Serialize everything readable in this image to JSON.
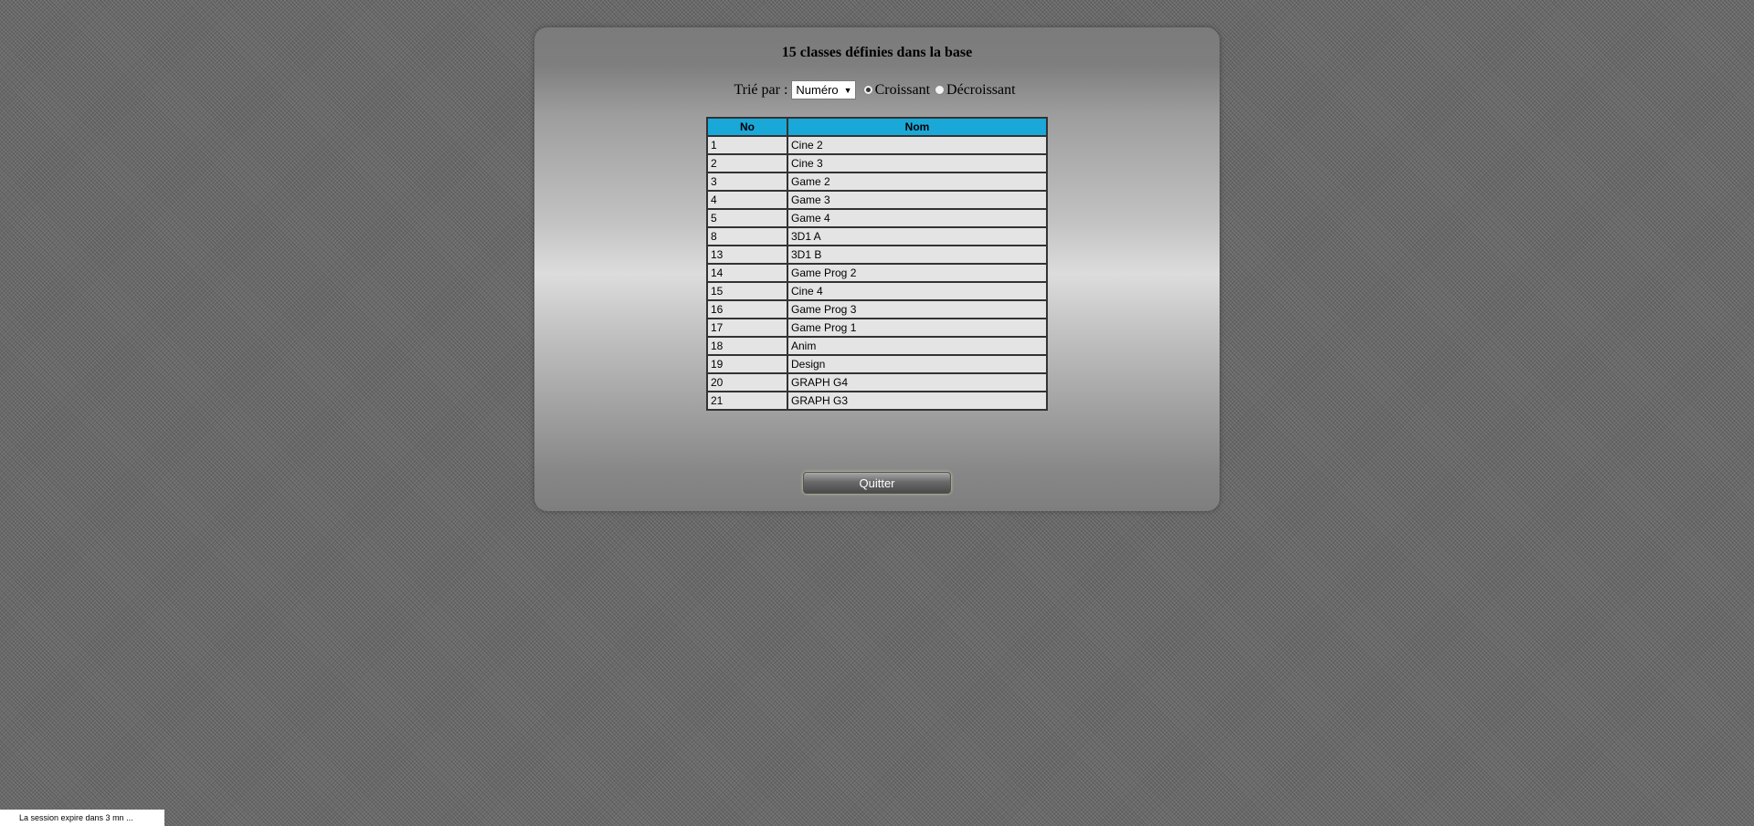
{
  "panel": {
    "title": "15 classes définies dans la base"
  },
  "sort": {
    "label": "Trié par :",
    "selected": "Numéro",
    "options": [
      {
        "label": "Croissant",
        "checked": true
      },
      {
        "label": "Décroissant",
        "checked": false
      }
    ]
  },
  "table": {
    "headers": [
      "No",
      "Nom"
    ],
    "header_color": "#1aa8d8",
    "rows": [
      [
        "1",
        "Cine 2"
      ],
      [
        "2",
        "Cine 3"
      ],
      [
        "3",
        "Game 2"
      ],
      [
        "4",
        "Game 3"
      ],
      [
        "5",
        "Game 4"
      ],
      [
        "8",
        "3D1 A"
      ],
      [
        "13",
        "3D1 B"
      ],
      [
        "14",
        "Game Prog 2"
      ],
      [
        "15",
        "Cine 4"
      ],
      [
        "16",
        "Game Prog 3"
      ],
      [
        "17",
        "Game Prog 1"
      ],
      [
        "18",
        "Anim"
      ],
      [
        "19",
        "Design"
      ],
      [
        "20",
        "GRAPH G4"
      ],
      [
        "21",
        "GRAPH G3"
      ]
    ]
  },
  "quit_label": "Quitter",
  "session_notice": "La session expire dans 3 mn ..."
}
